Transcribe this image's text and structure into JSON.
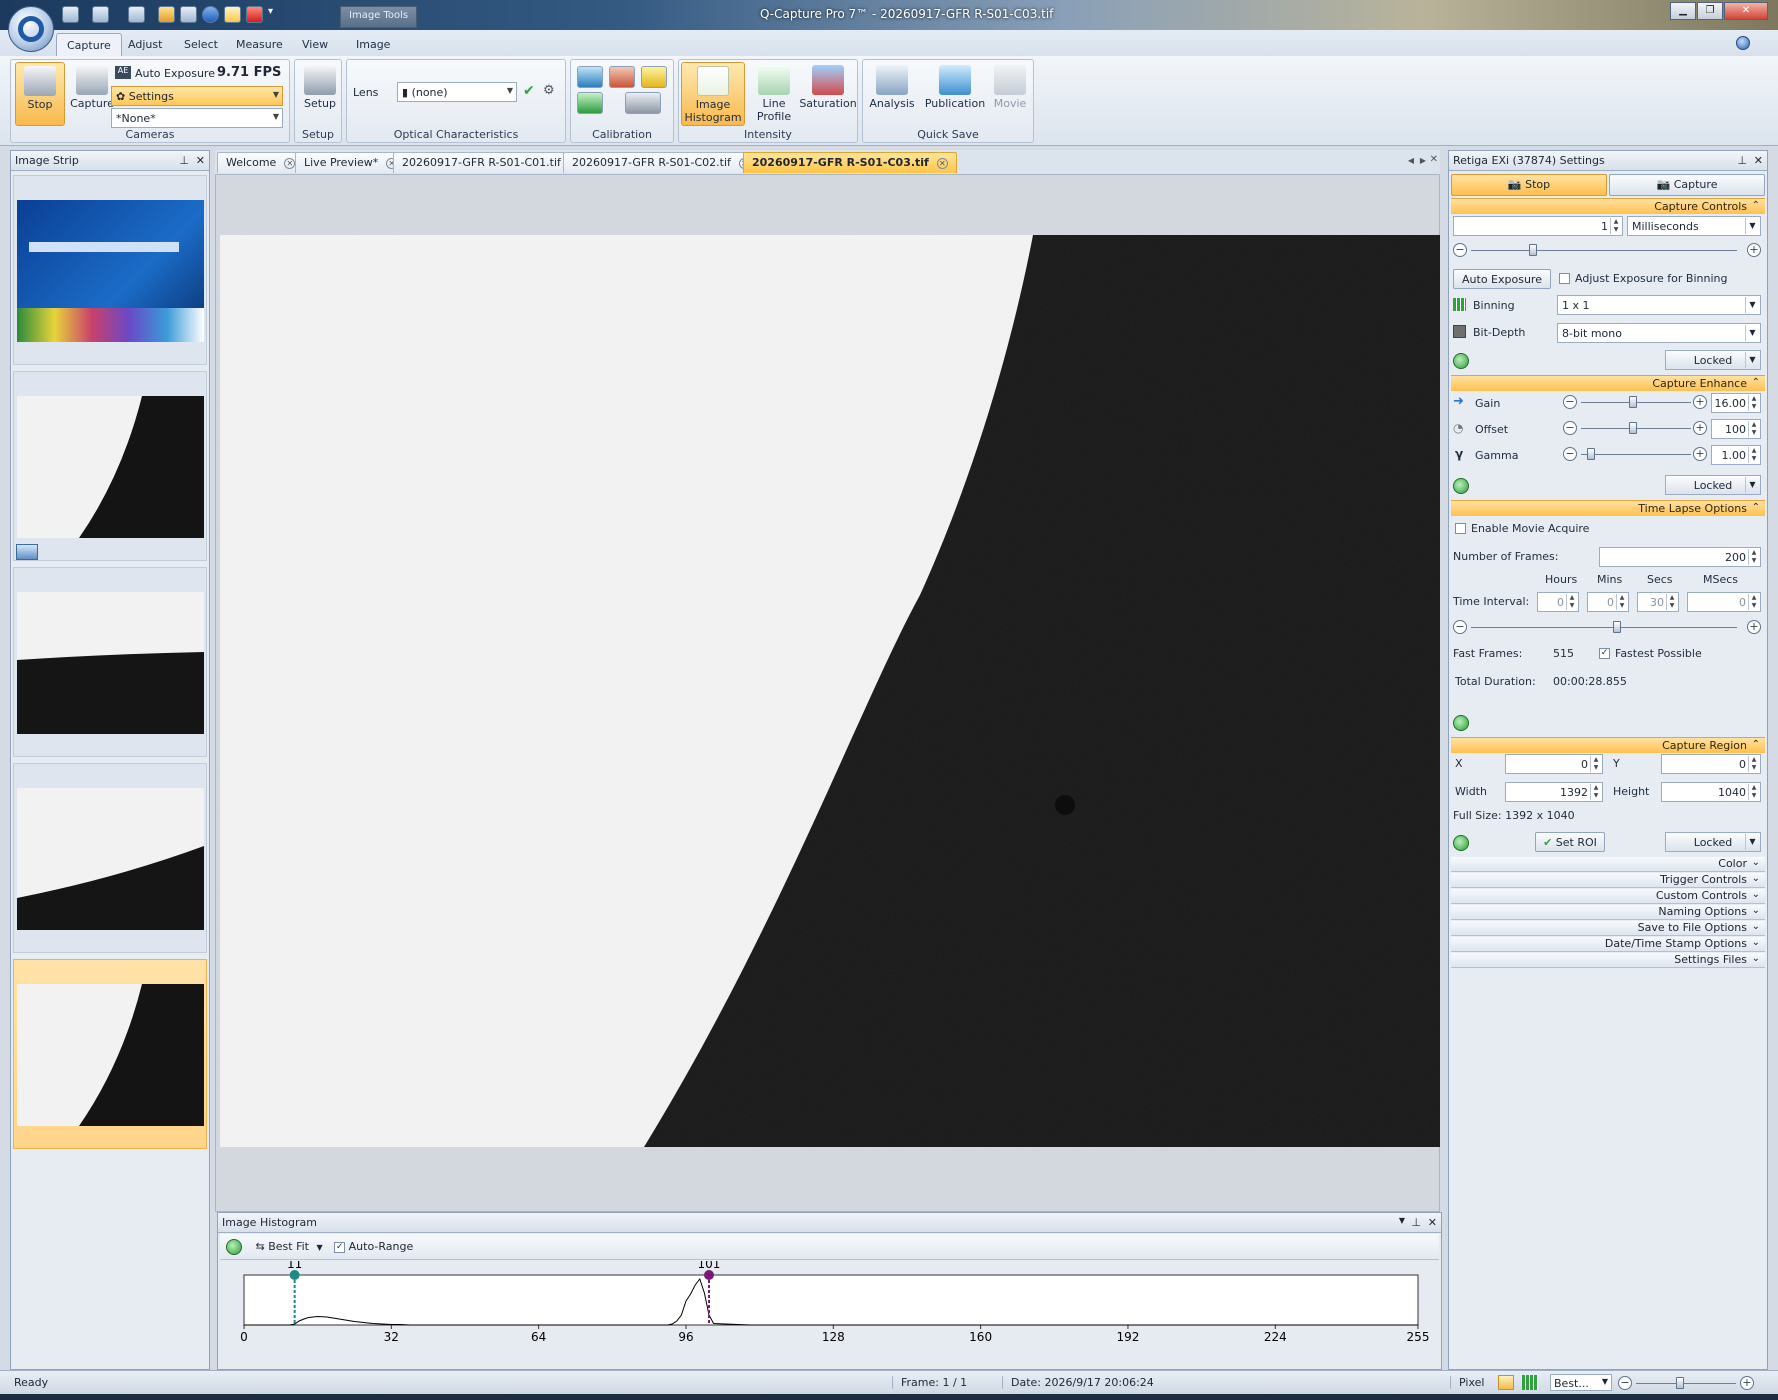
{
  "window": {
    "title": "Q-Capture Pro 7™ - 20260917-GFR R-S01-C03.tif",
    "image_tools": "Image Tools"
  },
  "ribbon_tabs": [
    "Capture",
    "Adjust",
    "Select",
    "Measure",
    "View",
    "Image"
  ],
  "ribbon": {
    "stop": "Stop",
    "capture": "Capture",
    "auto_exposure": "Auto Exposure",
    "fps": "9.71 FPS",
    "settings": "Settings",
    "preset": "*None*",
    "cameras_group": "Cameras",
    "setup": "Setup",
    "setup_group": "Setup",
    "lens_label": "Lens",
    "lens_value": "(none)",
    "optical_group": "Optical Characteristics",
    "calibration_group": "Calibration",
    "image_histogram": "Image Histogram",
    "line_profile": "Line Profile",
    "saturation": "Saturation",
    "intensity_group": "Intensity",
    "analysis": "Analysis",
    "publication": "Publication",
    "movie": "Movie",
    "quicksave_group": "Quick Save"
  },
  "image_strip": {
    "title": "Image Strip"
  },
  "doc_tabs": [
    "Welcome",
    "Live Preview*",
    "20260917-GFR R-S01-C01.tif",
    "20260917-GFR R-S01-C02.tif",
    "20260917-GFR R-S01-C03.tif"
  ],
  "histogram": {
    "title": "Image Histogram",
    "best_fit": "Best Fit",
    "auto_range": "Auto-Range",
    "marker_low": "11",
    "marker_high": "101",
    "ticks": [
      "0",
      "32",
      "64",
      "96",
      "128",
      "160",
      "192",
      "224",
      "255"
    ]
  },
  "chart_data": {
    "type": "line",
    "x": [
      0,
      8,
      9,
      10,
      11,
      12,
      13,
      14,
      16,
      18,
      20,
      22,
      24,
      26,
      28,
      30,
      32,
      34,
      36,
      40,
      90,
      92,
      93,
      94,
      95,
      96,
      97,
      98,
      99,
      100,
      101,
      102,
      110,
      255
    ],
    "values": [
      0,
      0,
      0,
      0,
      2,
      8,
      12,
      15,
      17,
      16,
      13,
      10,
      7,
      5,
      3,
      2,
      1,
      1,
      0,
      0,
      0,
      0,
      2,
      8,
      20,
      48,
      62,
      80,
      92,
      64,
      20,
      3,
      0,
      0
    ],
    "xlim": [
      0,
      255
    ],
    "x_ticks": [
      0,
      32,
      64,
      96,
      128,
      160,
      192,
      224,
      255
    ],
    "low_marker": 11,
    "high_marker": 101,
    "colors": {
      "low": "#1c8a85",
      "high": "#7a1a78"
    }
  },
  "settings_panel": {
    "title": "Retiga EXi (37874) Settings",
    "stop": "Stop",
    "capture": "Capture",
    "capture_controls": "Capture Controls",
    "exposure_value": "1",
    "exposure_unit": "Milliseconds",
    "auto_exposure": "Auto Exposure",
    "adjust_binning": "Adjust Exposure for Binning",
    "binning_label": "Binning",
    "binning_value": "1 x 1",
    "bitdepth_label": "Bit-Depth",
    "bitdepth_value": "8-bit mono",
    "locked": "Locked",
    "capture_enhance": "Capture Enhance",
    "gain_label": "Gain",
    "gain_value": "16.00",
    "offset_label": "Offset",
    "offset_value": "100",
    "gamma_label": "Gamma",
    "gamma_value": "1.00",
    "time_lapse": "Time Lapse Options",
    "enable_movie": "Enable Movie Acquire",
    "num_frames_label": "Number of  Frames:",
    "num_frames": "200",
    "hours": "Hours",
    "mins": "Mins",
    "secs": "Secs",
    "msecs": "MSecs",
    "time_interval": "Time Interval:",
    "t_hours": "0",
    "t_mins": "0",
    "t_secs": "30",
    "t_msecs": "0",
    "fast_frames_label": "Fast Frames:",
    "fast_frames": "515",
    "fastest": "Fastest Possible",
    "total_duration_label": "Total Duration:",
    "total_duration": "00:00:28.855",
    "capture_region": "Capture Region",
    "x_label": "X",
    "x_val": "0",
    "y_label": "Y",
    "y_val": "0",
    "width_label": "Width",
    "width_val": "1392",
    "height_label": "Height",
    "height_val": "1040",
    "full_size": "Full Size: 1392 x 1040",
    "set_roi": "Set ROI",
    "collapsed": [
      "Color",
      "Trigger Controls",
      "Custom Controls",
      "Naming Options",
      "Save to File Options",
      "Date/Time Stamp Options",
      "Settings Files"
    ]
  },
  "status": {
    "ready": "Ready",
    "frame": "Frame: 1 / 1",
    "date": "Date: 2026/9/17 20:06:24",
    "pixel": "Pixel",
    "zoom": "Best..."
  }
}
